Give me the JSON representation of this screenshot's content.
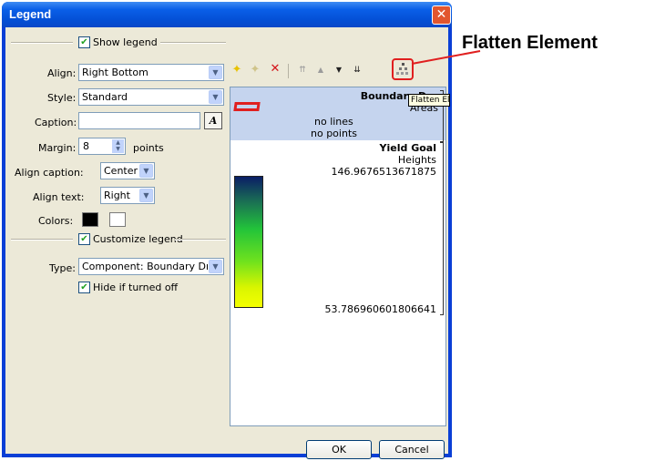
{
  "window": {
    "title": "Legend",
    "close_icon": "close-icon"
  },
  "show_legend": {
    "label": "Show legend",
    "checked": true
  },
  "align": {
    "label": "Align:",
    "value": "Right Bottom"
  },
  "style": {
    "label": "Style:",
    "value": "Standard"
  },
  "caption": {
    "label": "Caption:",
    "value": "",
    "font_button": "A"
  },
  "margin": {
    "label": "Margin:",
    "value": "8",
    "unit": "points"
  },
  "align_caption": {
    "label": "Align caption:",
    "value": "Center"
  },
  "align_text": {
    "label": "Align text:",
    "value": "Right"
  },
  "colors": {
    "label": "Colors:",
    "foreground": "#000000",
    "background": "#ffffff"
  },
  "customize_legend": {
    "label": "Customize legend",
    "checked": true
  },
  "type": {
    "label": "Type:",
    "value": "Component: Boundary Draw"
  },
  "hide_if_off": {
    "label": "Hide if turned off",
    "checked": true
  },
  "toolbar": {
    "tooltip": "Flatten Element"
  },
  "preview": {
    "item1_title": "Boundary Dra",
    "item1_sub": "Areas",
    "item1_line1": "no lines",
    "item1_line2": "no points",
    "item2_title": "Yield Goal",
    "item2_sub": "Heights",
    "item2_max": "146.9676513671875",
    "item2_min": "53.786960601806641"
  },
  "buttons": {
    "ok": "OK",
    "cancel": "Cancel"
  },
  "annotation": {
    "label": "Flatten Element",
    "color": "#e01f1f"
  }
}
